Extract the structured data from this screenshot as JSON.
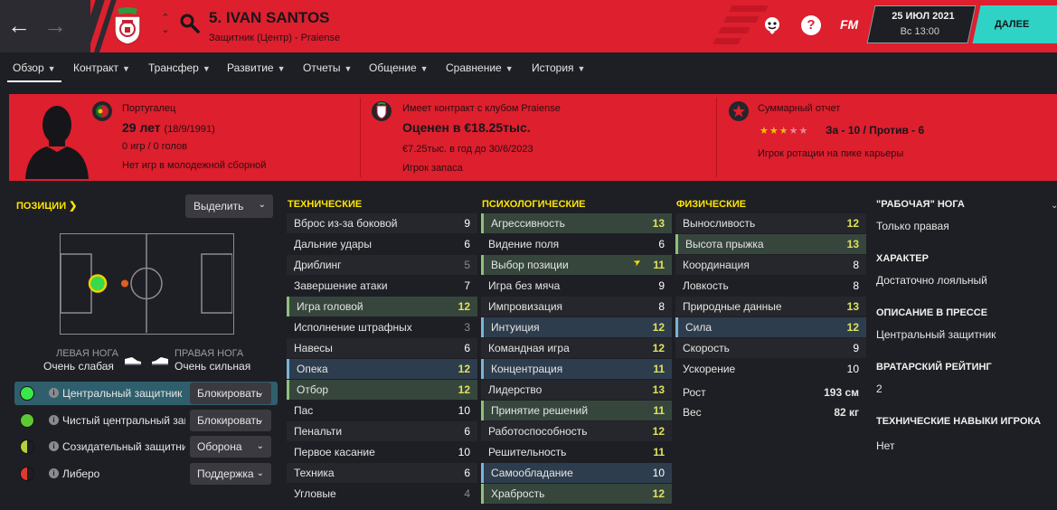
{
  "header": {
    "player_name": "5. IVAN SANTOS",
    "player_subtitle": "Защитник (Центр) - Praiense",
    "date": "25 ИЮЛ 2021",
    "time": "Вс 13:00",
    "next_label": "ДАЛЕЕ",
    "fm_logo": "FM",
    "help_label": "?"
  },
  "icons": {
    "back": "back-arrow-icon",
    "forward": "forward-arrow-icon",
    "search": "search-icon",
    "club": "club-crest-icon",
    "feedback": "feedback-icon",
    "help": "help-icon"
  },
  "tabs": [
    {
      "label": "Обзор",
      "active": true
    },
    {
      "label": "Контракт"
    },
    {
      "label": "Трансфер"
    },
    {
      "label": "Развитие"
    },
    {
      "label": "Отчеты"
    },
    {
      "label": "Общение"
    },
    {
      "label": "Сравнение"
    },
    {
      "label": "История"
    }
  ],
  "summary": {
    "nationality": "Португалец",
    "age": "29 лет",
    "dob": "(18/9/1991)",
    "games_goals": "0 игр / 0 голов",
    "youth_caps": "Нет игр в молодежной сборной",
    "contract_header": "Имеет контракт с клубом Praiense",
    "valuation": "Оценен в €18.25тыс.",
    "wage": "€7.25тыс. в год до 30/6/2023",
    "squad_status": "Игрок запаса",
    "report_header": "Суммарный отчет",
    "stars_rating": 2.5,
    "stars_max": 5,
    "pros_cons": "За - 10 / Против - 6",
    "report_summary": "Игрок ротации на пике карьеры"
  },
  "positions": {
    "title": "ПОЗИЦИИ",
    "highlight_button": "Выделить",
    "left_foot_label": "ЛЕВАЯ НОГА",
    "left_foot_value": "Очень слабая",
    "right_foot_label": "ПРАВАЯ НОГА",
    "right_foot_value": "Очень сильная",
    "roles": [
      {
        "name": "Центральный защитник",
        "duty": "Блокировать",
        "color": "#3be84a",
        "selected": true
      },
      {
        "name": "Чистый центральный защитник",
        "duty": "Блокировать",
        "color": "#5ec834"
      },
      {
        "name": "Созидательный защитник",
        "duty": "Оборона",
        "color": "#b4d23a"
      },
      {
        "name": "Либеро",
        "duty": "Поддержка",
        "color": "#e03a2e"
      }
    ]
  },
  "technical": {
    "title": "ТЕХНИЧЕСКИЕ",
    "items": [
      {
        "name": "Вброс из-за боковой",
        "value": "9"
      },
      {
        "name": "Дальние удары",
        "value": "6"
      },
      {
        "name": "Дриблинг",
        "value": "5"
      },
      {
        "name": "Завершение атаки",
        "value": "7"
      },
      {
        "name": "Игра головой",
        "value": "12",
        "hl": "green"
      },
      {
        "name": "Исполнение штрафных",
        "value": "3"
      },
      {
        "name": "Навесы",
        "value": "6"
      },
      {
        "name": "Опека",
        "value": "12",
        "hl": "blue"
      },
      {
        "name": "Отбор",
        "value": "12",
        "hl": "green"
      },
      {
        "name": "Пас",
        "value": "10"
      },
      {
        "name": "Пенальти",
        "value": "6"
      },
      {
        "name": "Первое касание",
        "value": "10"
      },
      {
        "name": "Техника",
        "value": "6"
      },
      {
        "name": "Угловые",
        "value": "4"
      }
    ]
  },
  "mental": {
    "title": "ПСИХОЛОГИЧЕСКИЕ",
    "items": [
      {
        "name": "Агрессивность",
        "value": "13",
        "hl": "green"
      },
      {
        "name": "Видение поля",
        "value": "6"
      },
      {
        "name": "Выбор позиции",
        "value": "11",
        "hl": "green",
        "arrow": true
      },
      {
        "name": "Игра без мяча",
        "value": "9"
      },
      {
        "name": "Импровизация",
        "value": "8"
      },
      {
        "name": "Интуиция",
        "value": "12",
        "hl": "blue"
      },
      {
        "name": "Командная игра",
        "value": "12"
      },
      {
        "name": "Концентрация",
        "value": "11",
        "hl": "blue"
      },
      {
        "name": "Лидерство",
        "value": "13"
      },
      {
        "name": "Принятие решений",
        "value": "11",
        "hl": "green"
      },
      {
        "name": "Работоспособность",
        "value": "12"
      },
      {
        "name": "Решительность",
        "value": "11"
      },
      {
        "name": "Самообладание",
        "value": "10",
        "hl": "blue"
      },
      {
        "name": "Храбрость",
        "value": "12",
        "hl": "green"
      }
    ]
  },
  "physical": {
    "title": "ФИЗИЧЕСКИЕ",
    "items": [
      {
        "name": "Выносливость",
        "value": "12"
      },
      {
        "name": "Высота прыжка",
        "value": "13",
        "hl": "green"
      },
      {
        "name": "Координация",
        "value": "8"
      },
      {
        "name": "Ловкость",
        "value": "8"
      },
      {
        "name": "Природные данные",
        "value": "13"
      },
      {
        "name": "Сила",
        "value": "12",
        "hl": "blue"
      },
      {
        "name": "Скорость",
        "value": "9"
      },
      {
        "name": "Ускорение",
        "value": "10"
      }
    ],
    "height_label": "Рост",
    "height_value": "193 см",
    "weight_label": "Вес",
    "weight_value": "82 кг"
  },
  "info": [
    {
      "head": "\"РАБОЧАЯ\" НОГА",
      "value": "Только правая"
    },
    {
      "head": "ХАРАКТЕР",
      "value": "Достаточно лояльный"
    },
    {
      "head": "ОПИСАНИЕ В ПРЕССЕ",
      "value": "Центральный защитник"
    },
    {
      "head": "ВРАТАРСКИЙ РЕЙТИНГ",
      "value": "2"
    },
    {
      "head": "ТЕХНИЧЕСКИЕ НАВЫКИ ИГРОКА",
      "value": "Нет"
    }
  ],
  "colors": {
    "brand_red": "#dd1f2e",
    "accent_teal": "#2fd3c6",
    "section_yellow": "#ffe600",
    "attr_high": "#dfe35a",
    "attr_mid": "#ffffff",
    "attr_low": "#8a8a90"
  }
}
